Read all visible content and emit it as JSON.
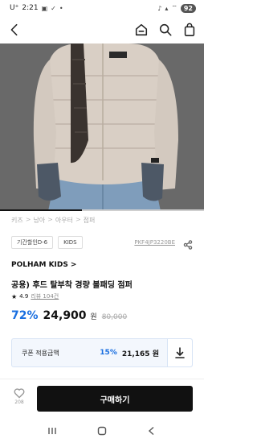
{
  "status_bar": {
    "carrier": "U⁺",
    "time": "2:21",
    "battery": "92",
    "left_icons": [
      "gallery-icon",
      "check-icon",
      "dot-icon"
    ],
    "right_icons": [
      "mute-icon",
      "signal-icon",
      "wifi-icon"
    ]
  },
  "header": {
    "icons": [
      "back-arrow-icon",
      "home-icon",
      "search-icon",
      "shopping-bag-icon"
    ]
  },
  "product_image": {
    "colors": {
      "background": "#6f6f6f",
      "jacket": "#d9cfc5",
      "scarf": "#3a332f",
      "jeans": "#7f9dbb",
      "gloves": "#4d5866"
    },
    "image_progress": 0.4
  },
  "breadcrumb": [
    "키즈",
    "남아",
    "아우터",
    "점퍼"
  ],
  "breadcrumb_separator": ">",
  "tags": [
    "기간할인D-6",
    "KIDS"
  ],
  "product_code": "PKF4JP3220BE",
  "brand": {
    "name": "POLHAM KIDS",
    "chevron": ">"
  },
  "product": {
    "name": "공용) 후드 탈부착 경량 볼패딩 점퍼",
    "rating": "4.9",
    "review_link": "리뷰 104건",
    "discount": "72%",
    "price": "24,900",
    "price_unit": "원",
    "original_price": "80,000"
  },
  "coupon": {
    "label": "쿠폰 적용금액",
    "discount": "15%",
    "price": "21,165",
    "price_unit": "원"
  },
  "bottom_bar": {
    "like_count": "208",
    "buy_label": "구매하기"
  },
  "colors": {
    "accent": "#1a6fe0",
    "buy_button": "#111111"
  }
}
